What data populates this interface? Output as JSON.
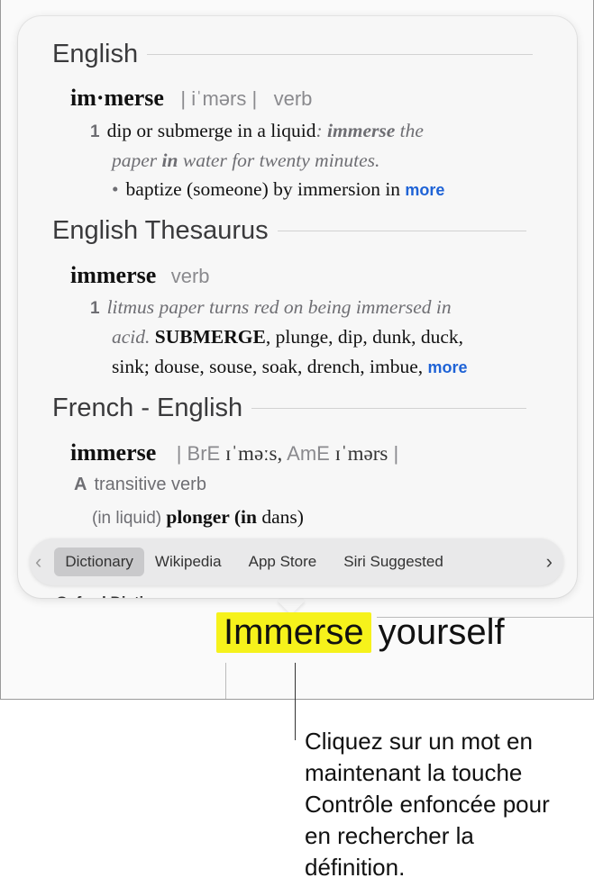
{
  "sections": {
    "english": {
      "title": "English",
      "headword": "im·merse",
      "pronunciation": "| iˈmərs |",
      "pos": "verb",
      "sense_num": "1",
      "def": "dip or submerge in a liquid",
      "example_1_colon": ": ",
      "example_1a": "immerse",
      "example_1b": " the",
      "example_2a": "paper ",
      "example_2b": "in",
      "example_2c": " water for twenty minutes.",
      "bullet": "•",
      "subsense": "baptize (someone) by immersion in",
      "more": "more"
    },
    "thesaurus": {
      "title": "English Thesaurus",
      "headword": "immerse",
      "pos": "verb",
      "sense_num": "1",
      "line_1": "litmus paper turns red on being immersed in",
      "line_2_ital": "acid.",
      "line_2_bold": " SUBMERGE",
      "line_2_rest": ", plunge, dip, dunk, duck,",
      "line_3": "sink; douse, souse, soak, drench, imbue, ",
      "more": "more"
    },
    "french": {
      "title": "French - English",
      "headword": "immerse",
      "pron_sep1": "| BrE",
      "pron_bre": " ɪˈməːs,",
      "pron_ame_label": "  AmE",
      "pron_ame": " ɪˈmərs",
      "pron_sep2": " |",
      "letter": "A",
      "pos": "transitive verb",
      "gloss": "(in liquid) ",
      "trans_a": "plonger (",
      "trans_b": "in",
      "trans_c": " dans)"
    }
  },
  "clipped_text": "Oxford Dictionary",
  "toolbar": {
    "prev_icon": "chevron-left-icon",
    "next_icon": "chevron-right-icon",
    "tabs": [
      "Dictionary",
      "Wikipedia",
      "App Store",
      "Siri Suggested"
    ],
    "active_tab": "Dictionary"
  },
  "document": {
    "highlighted_word": "Immerse",
    "rest": "yourself"
  },
  "caption": "Cliquez sur un mot en maintenant la touche Contrôle enfoncée pour en rechercher la définition.",
  "colors": {
    "highlight": "#f6f21b",
    "link": "#1f63d6"
  }
}
